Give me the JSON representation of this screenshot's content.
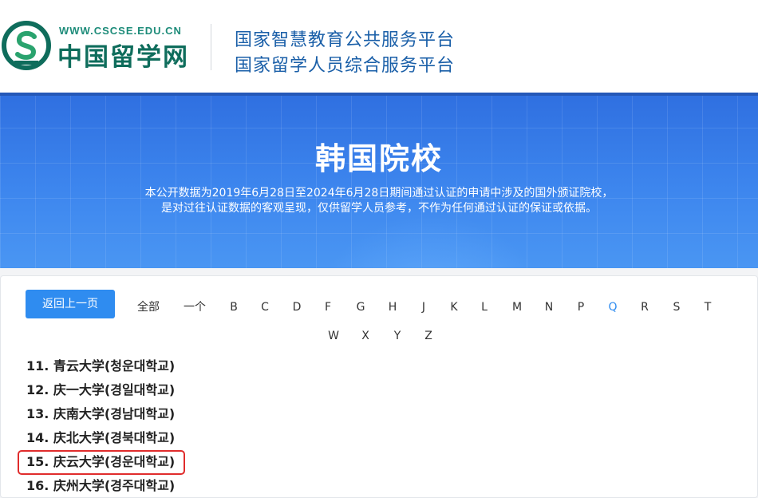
{
  "header": {
    "logo_url": "WWW.CSCSE.EDU.CN",
    "logo_name": "中国留学网",
    "platform_line1": "国家智慧教育公共服务平台",
    "platform_line2": "国家留学人员综合服务平台"
  },
  "banner": {
    "title": "韩国院校",
    "desc_line1": "本公开数据为2019年6月28日至2024年6月28日期间通过认证的申请中涉及的国外颁证院校，",
    "desc_line2": "是对过往认证数据的客观呈现，仅供留学人员参考，不作为任何通过认证的保证或依据。"
  },
  "nav": {
    "back_label": "返回上一页",
    "filters": [
      "全部",
      "一个",
      "B",
      "C",
      "D",
      "F",
      "G",
      "H",
      "J",
      "K",
      "L",
      "M",
      "N",
      "P",
      "Q",
      "R",
      "S",
      "T",
      "W",
      "X",
      "Y",
      "Z"
    ],
    "active_filter": "Q"
  },
  "universities": [
    "11. 青云大学(청운대학교)",
    "12. 庆一大学(경일대학교)",
    "13. 庆南大学(경남대학교)",
    "14. 庆北大学(경북대학교)",
    "15. 庆云大学(경운대학교)",
    "16. 庆州大学(경주대학교)"
  ],
  "highlighted_item": "15. 庆云大学(경운대학교)",
  "colors": {
    "accent": "#2f8cf0",
    "highlight": "#e02c2c",
    "logo_green": "#0f6d5c",
    "platform_blue": "#1a5fa8"
  }
}
